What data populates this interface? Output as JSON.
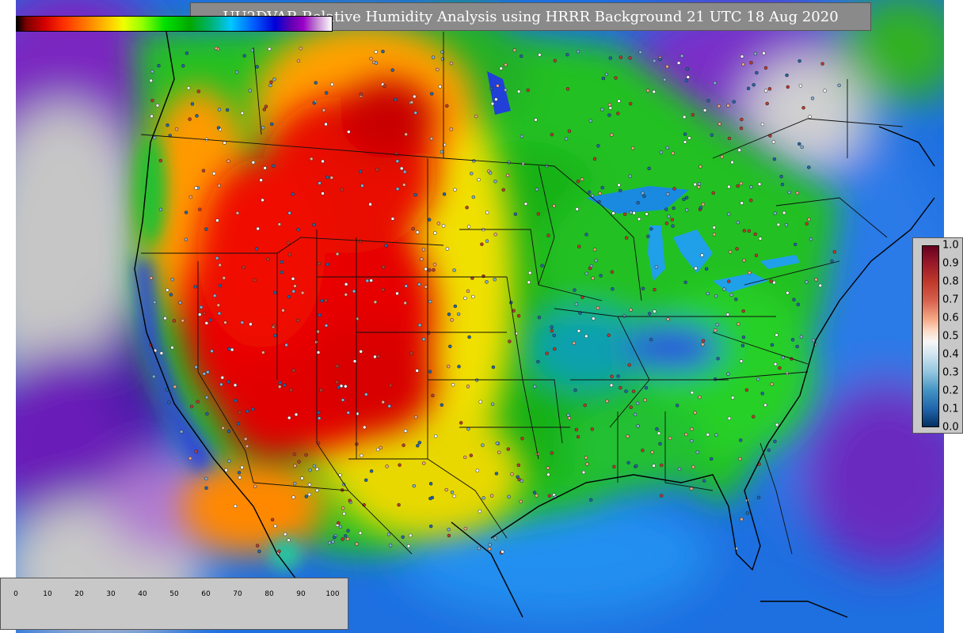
{
  "title": "UU2DVAR Relative Humidity Analysis using HRRR Background 21 UTC 18 Aug 2020",
  "colors": {
    "ocean": "#1e6fe0",
    "pacific_deep": "#6a1fb8",
    "dry_core": "#e60000",
    "moist": "#18c018",
    "panel_bg": "#c8c8c8",
    "title_bg": "#8a8a8a"
  },
  "rh_colorbar": {
    "ticks": [
      "0",
      "10",
      "20",
      "30",
      "40",
      "50",
      "60",
      "70",
      "80",
      "90",
      "100"
    ]
  },
  "analysis_colorbar": {
    "ticks": [
      "1.0",
      "0.9",
      "0.8",
      "0.7",
      "0.6",
      "0.5",
      "0.4",
      "0.3",
      "0.2",
      "0.1",
      "0.0"
    ]
  }
}
